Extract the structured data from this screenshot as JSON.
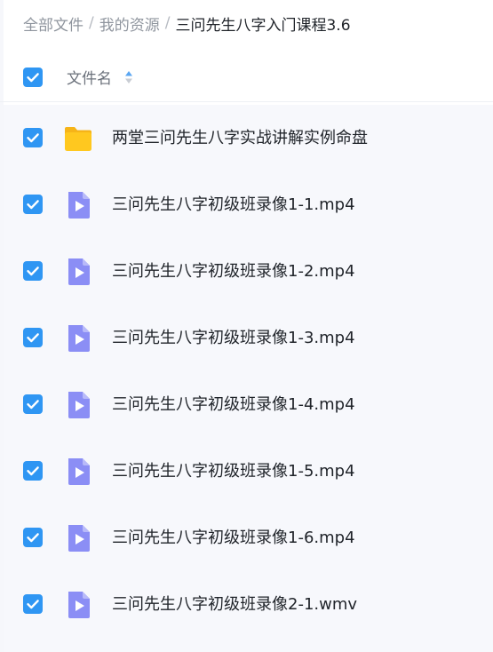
{
  "breadcrumb": {
    "items": [
      "全部文件",
      "我的资源"
    ],
    "separator": "/",
    "current": "三问先生八字入门课程3.6"
  },
  "list_header": {
    "column_label": "文件名",
    "select_all_checked": true,
    "sort_icon": "sort-arrows-icon"
  },
  "files": [
    {
      "name": "两堂三问先生八字实战讲解实例命盘",
      "type": "folder",
      "icon": "folder-icon",
      "checked": true
    },
    {
      "name": "三问先生八字初级班录像1-1.mp4",
      "type": "video",
      "icon": "video-file-icon",
      "checked": true
    },
    {
      "name": "三问先生八字初级班录像1-2.mp4",
      "type": "video",
      "icon": "video-file-icon",
      "checked": true
    },
    {
      "name": "三问先生八字初级班录像1-3.mp4",
      "type": "video",
      "icon": "video-file-icon",
      "checked": true
    },
    {
      "name": "三问先生八字初级班录像1-4.mp4",
      "type": "video",
      "icon": "video-file-icon",
      "checked": true
    },
    {
      "name": "三问先生八字初级班录像1-5.mp4",
      "type": "video",
      "icon": "video-file-icon",
      "checked": true
    },
    {
      "name": "三问先生八字初级班录像1-6.mp4",
      "type": "video",
      "icon": "video-file-icon",
      "checked": true
    },
    {
      "name": "三问先生八字初级班录像2-1.wmv",
      "type": "video",
      "icon": "video-file-icon",
      "checked": true
    }
  ],
  "colors": {
    "checkbox": "#2f96f3",
    "folder": "#ffc81f",
    "video": "#8b8ef5"
  }
}
